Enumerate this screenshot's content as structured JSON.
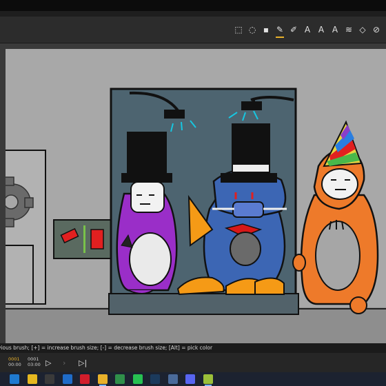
{
  "toolbar": {
    "tools": [
      {
        "name": "lasso-select-icon",
        "glyph": "⬚"
      },
      {
        "name": "lasso-free-icon",
        "glyph": "◌"
      },
      {
        "name": "fill-bucket-icon",
        "glyph": "▪"
      },
      {
        "name": "pen-tool-icon",
        "glyph": "✎",
        "active": true
      },
      {
        "name": "pencil-tool-icon",
        "glyph": "✐"
      },
      {
        "name": "brush-a-icon",
        "glyph": "A"
      },
      {
        "name": "brush-b-icon",
        "glyph": "A"
      },
      {
        "name": "brush-c-icon",
        "glyph": "A"
      },
      {
        "name": "smudge-tool-icon",
        "glyph": "≋"
      },
      {
        "name": "blur-tool-icon",
        "glyph": "◇"
      },
      {
        "name": "eraser-tool-icon",
        "glyph": "⊘"
      }
    ],
    "accent": "#e8b12a"
  },
  "status": {
    "text": "vious brush; [+] = increase brush size; [-] = decrease brush size; [Alt] = pick color"
  },
  "timeline": {
    "current_frame": "0001",
    "current_time": "00:00",
    "total_frame": "0001",
    "total_time": "03:00"
  },
  "taskbar": {
    "icons": [
      "edge-icon",
      "file-explorer-icon",
      "start-grid-icon",
      "outlook-icon",
      "opera-icon",
      "drawing-app-icon",
      "chrome-icon",
      "whatsapp-icon",
      "steam-icon",
      "game-icon",
      "discord-icon",
      "paint-icon"
    ]
  },
  "colors": {
    "canvas_bg": "#a8a8a8",
    "shower_wall": "#4d6470",
    "purple_char": "#9a2ec8",
    "blue_char": "#3c66b4",
    "orange_char": "#ee7a2a",
    "duck_orange": "#f59a16"
  }
}
